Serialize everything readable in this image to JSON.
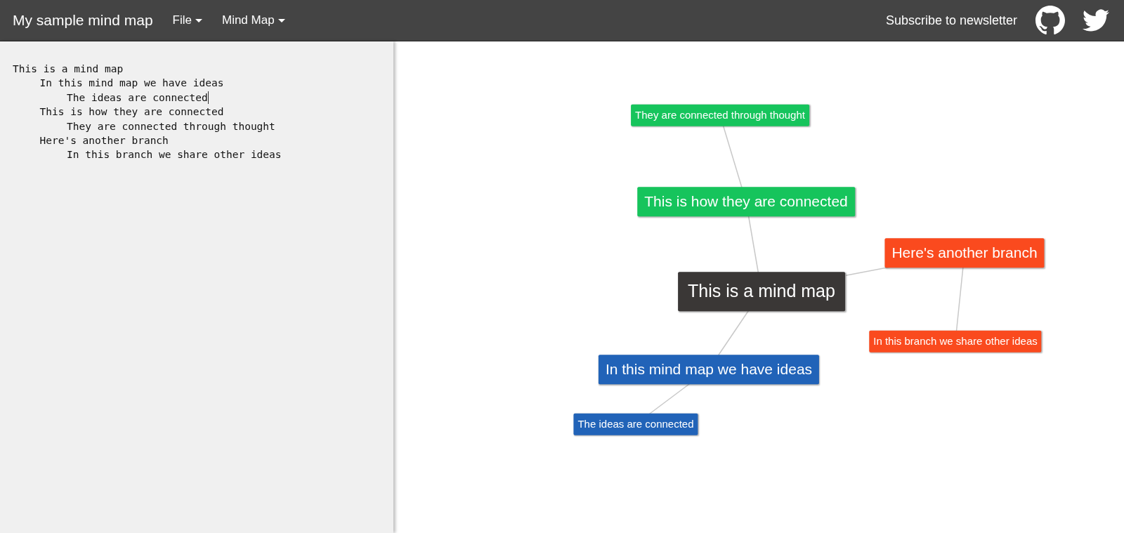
{
  "navbar": {
    "brand": "My sample mind map",
    "menus": [
      {
        "label": "File"
      },
      {
        "label": "Mind Map"
      }
    ],
    "subscribe": "Subscribe to newsletter"
  },
  "editor": {
    "outline": [
      {
        "text": "This is a mind map",
        "caret": false,
        "children": [
          {
            "text": "In this mind map we have ideas",
            "caret": false,
            "children": [
              {
                "text": "The ideas are connected",
                "caret": true
              }
            ]
          },
          {
            "text": "This is how they are connected",
            "caret": false,
            "children": [
              {
                "text": "They are connected through thought",
                "caret": false
              }
            ]
          },
          {
            "text": "Here's another branch",
            "caret": false,
            "children": [
              {
                "text": "In this branch we share other ideas",
                "caret": false
              }
            ]
          }
        ]
      }
    ]
  },
  "mind_map": {
    "root": {
      "text": "This is a mind map",
      "color": "#3a3736",
      "children": [
        {
          "text": "This is how they are connected",
          "color": "#16c45c",
          "children": [
            {
              "text": "They are connected through thought",
              "color": "#16c45c"
            }
          ]
        },
        {
          "text": "Here's another branch",
          "color": "#fa4a1e",
          "children": [
            {
              "text": "In this branch we share other ideas",
              "color": "#fa4a1e"
            }
          ]
        },
        {
          "text": "In this mind map we have ideas",
          "color": "#2163b8",
          "children": [
            {
              "text": "The ideas are connected",
              "color": "#2163b8"
            }
          ]
        }
      ]
    }
  }
}
